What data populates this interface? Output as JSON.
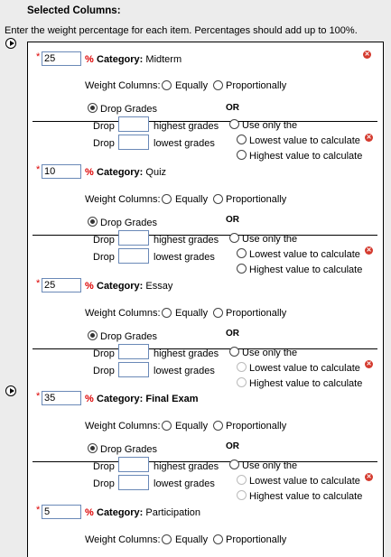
{
  "header": {
    "title": "Selected Columns:",
    "instructions": "Enter the weight percentage for each item. Percentages should add up to 100%."
  },
  "labels": {
    "required": "*",
    "percent": "%",
    "category_prefix": "Category:",
    "weight_columns": "Weight Columns:",
    "equally": "Equally",
    "proportionally": "Proportionally",
    "drop_grades": "Drop Grades",
    "or": "OR",
    "drop": "Drop",
    "highest_grades": "highest grades",
    "lowest_grades": "lowest grades",
    "use_only_the": "Use only the",
    "lowest_value": "Lowest value to calculate",
    "highest_value": "Highest value to calculate",
    "remove": "✕"
  },
  "categories": [
    {
      "weight": "25",
      "name": "Midterm"
    },
    {
      "weight": "10",
      "name": "Quiz"
    },
    {
      "weight": "25",
      "name": "Essay"
    },
    {
      "weight": "35",
      "name": "Final Exam"
    },
    {
      "weight": "5",
      "name": "Participation"
    }
  ],
  "icons": {
    "arrow": "play-circle-icon",
    "remove": "remove-x-icon"
  }
}
